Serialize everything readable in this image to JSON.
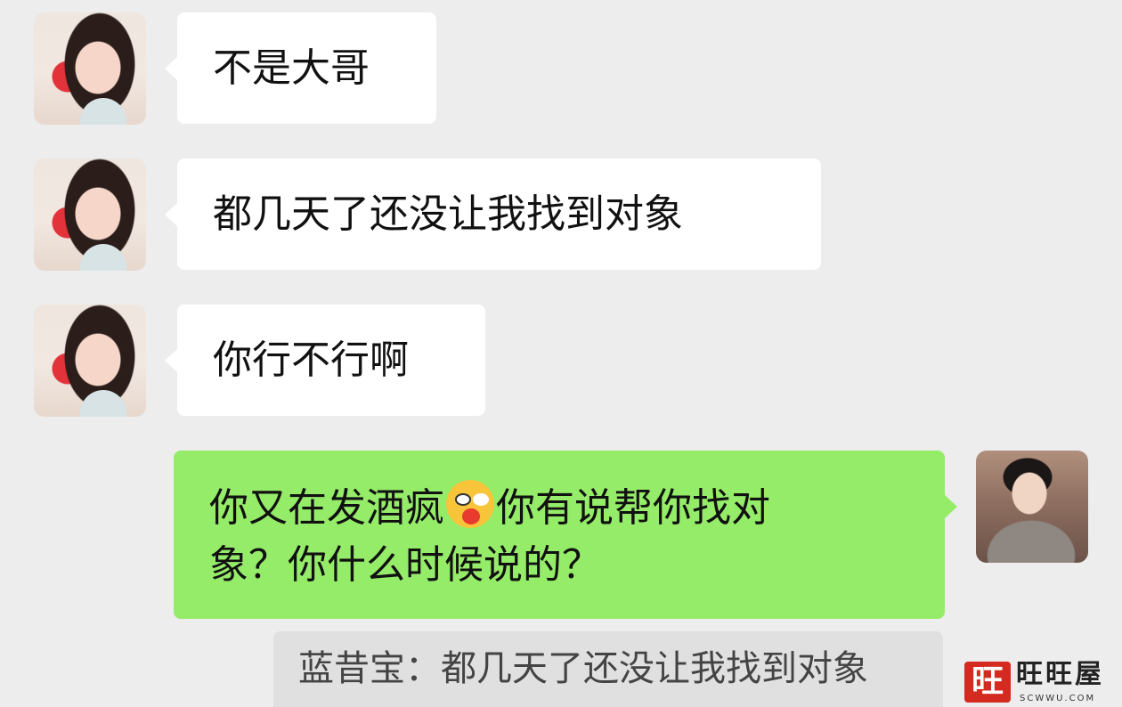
{
  "messages": [
    {
      "side": "left",
      "text": "不是大哥"
    },
    {
      "side": "left",
      "text": "都几天了还没让我找到对象"
    },
    {
      "side": "left",
      "text": "你行不行啊"
    },
    {
      "side": "right",
      "line1_a": "你又在发酒疯",
      "emoji": "drooling-face-emoji",
      "line1_b": "你有说帮你找对",
      "line2": "象？你什么时候说的？"
    }
  ],
  "quote": {
    "text": "蓝昔宝：都几天了还没让我找到对象"
  },
  "watermark": {
    "badge": "旺",
    "name": "旺旺屋",
    "domain": "SCWWU.COM"
  },
  "colors": {
    "background": "#ededed",
    "incoming_bubble": "#ffffff",
    "outgoing_bubble": "#95ec69",
    "quote_bg": "#e0e0e0"
  }
}
